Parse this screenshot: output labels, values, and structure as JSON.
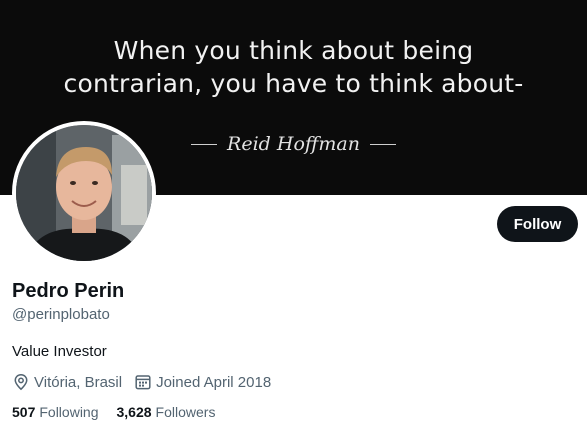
{
  "banner": {
    "quote_line1": "When you think about being",
    "quote_line2": "contrarian, you have to think about-",
    "author": "Reid Hoffman"
  },
  "profile": {
    "name": "Pedro Perin",
    "handle": "@perinplobato",
    "bio": "Value Investor",
    "location": "Vitória, Brasil",
    "joined": "Joined April 2018",
    "following_count": "507",
    "following_label": "Following",
    "followers_count": "3,628",
    "followers_label": "Followers"
  },
  "actions": {
    "follow_label": "Follow"
  },
  "icons": {
    "location": "location-pin-icon",
    "calendar": "calendar-icon"
  },
  "colors": {
    "banner_bg": "#0b0b0b",
    "button_bg": "#0f1419",
    "secondary_text": "#536471"
  }
}
